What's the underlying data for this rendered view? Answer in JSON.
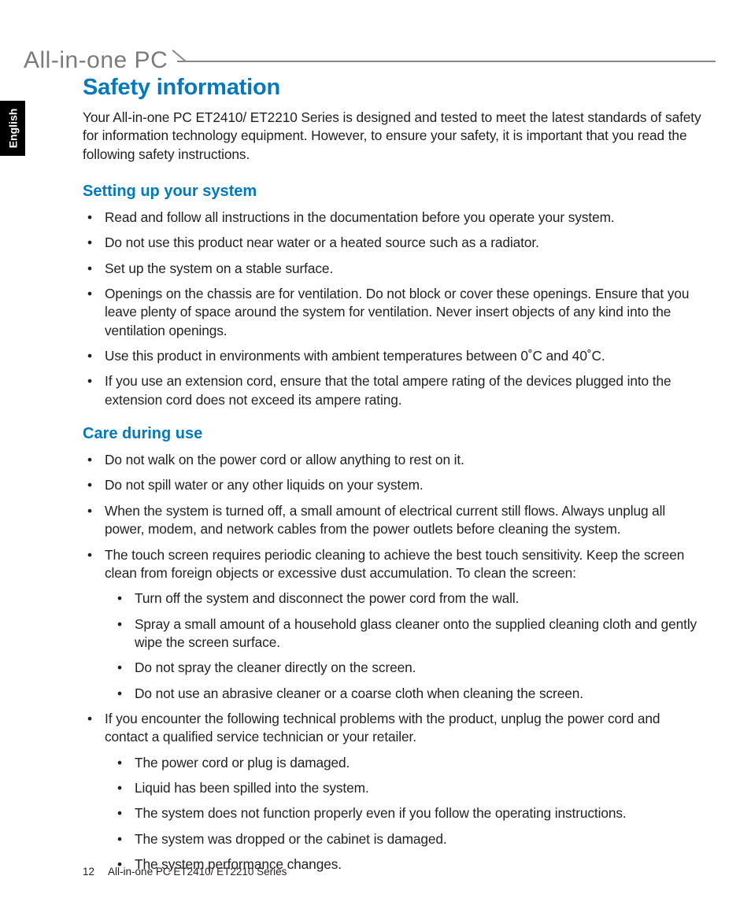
{
  "language_tab": "English",
  "header": "All-in-one PC",
  "title": "Safety information",
  "intro": "Your All-in-one PC ET2410/ ET2210 Series is designed and tested to meet the latest standards of safety for information technology equipment. However, to ensure your safety, it is important that you read the following safety instructions.",
  "sections": [
    {
      "heading": "Setting up your system",
      "items": [
        {
          "text": "Read and follow all instructions in the documentation before you operate your system."
        },
        {
          "text": "Do not use this product near water or a heated source such as a radiator."
        },
        {
          "text": "Set up the system on a stable surface."
        },
        {
          "text": "Openings on the chassis are for ventilation. Do not block or cover these openings. Ensure that you leave plenty of space around the system for ventilation. Never insert objects of any kind into the ventilation openings."
        },
        {
          "text": "Use this product in environments with ambient temperatures between 0˚C and 40˚C."
        },
        {
          "text": "If you use an extension cord, ensure that the total ampere rating of the devices plugged into the extension cord does not exceed its ampere rating."
        }
      ]
    },
    {
      "heading": "Care during use",
      "items": [
        {
          "text": "Do not walk on the power cord or allow anything to rest on it."
        },
        {
          "text": "Do not spill water or any other liquids on your system."
        },
        {
          "text": "When the system is turned off, a small amount of electrical current still flows. Always unplug all power, modem, and network cables from the power outlets before cleaning the system."
        },
        {
          "text": "The touch screen requires periodic cleaning to achieve the best touch sensitivity. Keep the screen clean from foreign objects or excessive dust accumulation. To clean the screen:",
          "sub": [
            "Turn off the system and disconnect the power cord from the wall.",
            "Spray a small amount of a household glass cleaner onto the supplied cleaning cloth and gently wipe the screen surface.",
            "Do not spray the cleaner directly on the screen.",
            "Do not use an abrasive cleaner or a coarse cloth when cleaning the screen."
          ]
        },
        {
          "text": "If you encounter the following technical problems with the product, unplug the power cord and contact a qualified service technician or your retailer.",
          "sub": [
            "The power cord or plug is damaged.",
            "Liquid has been spilled into the system.",
            "The system does not function properly even if you follow the operating instructions.",
            "The system was dropped or the cabinet is damaged.",
            "The system performance changes."
          ]
        }
      ]
    }
  ],
  "footer": {
    "page": "12",
    "series": "All-in-one PC ET2410/ ET2210 Series"
  }
}
